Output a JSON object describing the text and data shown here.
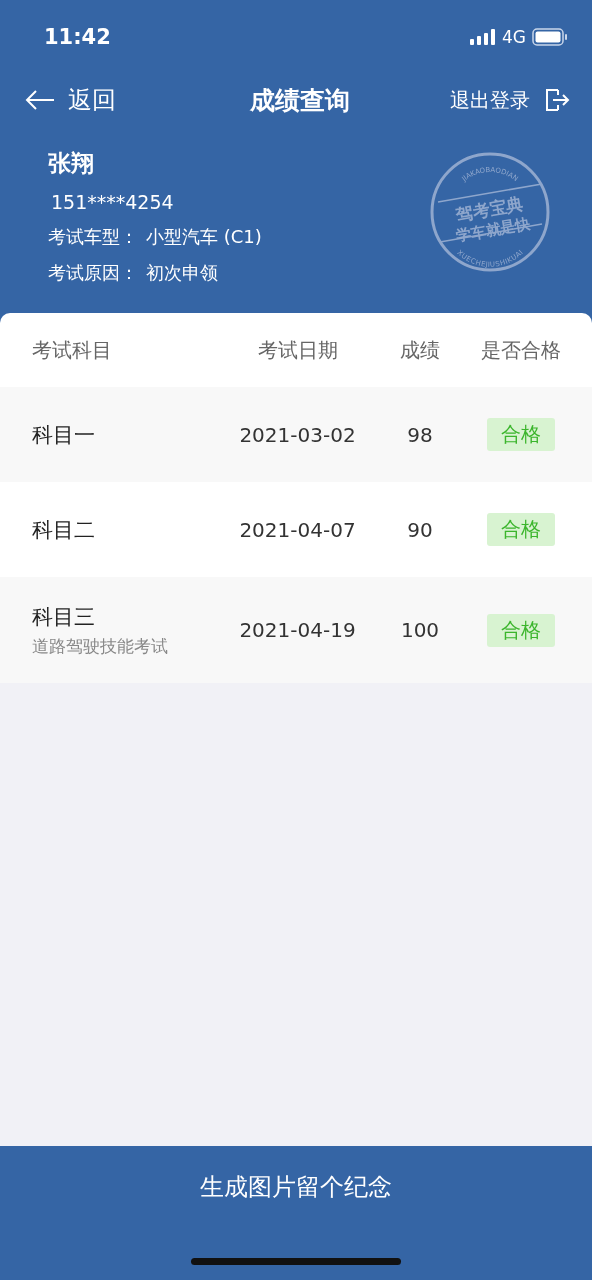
{
  "status_bar": {
    "time": "11:42",
    "network": "4G"
  },
  "nav": {
    "back": "返回",
    "title": "成绩查询",
    "logout": "退出登录"
  },
  "profile": {
    "name": "张翔",
    "phone": "151****4254",
    "fields": [
      {
        "label": "考试车型：",
        "value": "小型汽车 (C1)"
      },
      {
        "label": "考试原因：",
        "value": "初次申领"
      }
    ]
  },
  "seal": {
    "top_arc": "JIAKAOBAODIAN",
    "line_1": "驾考宝典",
    "line_2": "学车就是快",
    "bottom_arc": "XUECHEJIUSHIKUAI"
  },
  "table": {
    "columns": [
      "考试科目",
      "考试日期",
      "成绩",
      "是否合格"
    ],
    "rows": [
      {
        "subject": "科目一",
        "date": "2021-03-02",
        "score": "98",
        "result": "合格",
        "passed": true
      },
      {
        "subject": "科目二",
        "date": "2021-04-07",
        "score": "90",
        "result": "合格",
        "passed": true
      },
      {
        "subject": "科目三",
        "note": "道路驾驶技能考试",
        "date": "2021-04-19",
        "score": "100",
        "result": "合格",
        "passed": true
      }
    ]
  },
  "footer_button": "生成图片留个纪念"
}
